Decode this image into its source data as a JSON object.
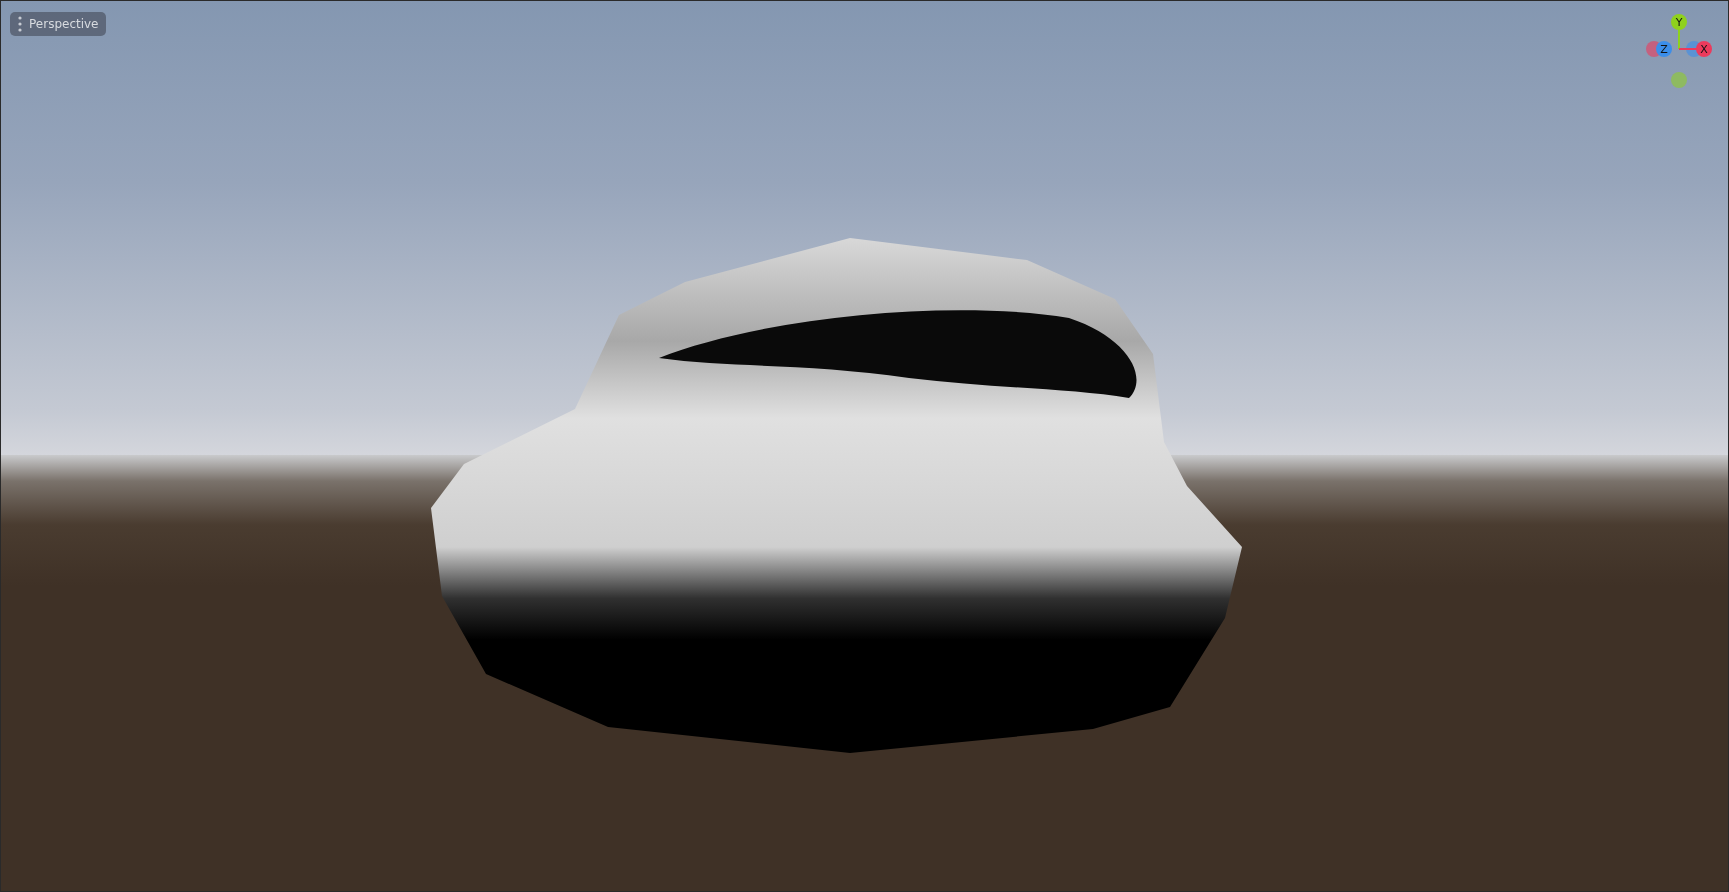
{
  "viewport": {
    "view_menu": {
      "label": "Perspective"
    },
    "gizmo": {
      "axes": [
        {
          "label": "Y",
          "color": "#8fd11c"
        },
        {
          "label": "Z",
          "color": "#3b8eea"
        },
        {
          "label": "X",
          "color": "#ec3a5c"
        }
      ]
    }
  }
}
